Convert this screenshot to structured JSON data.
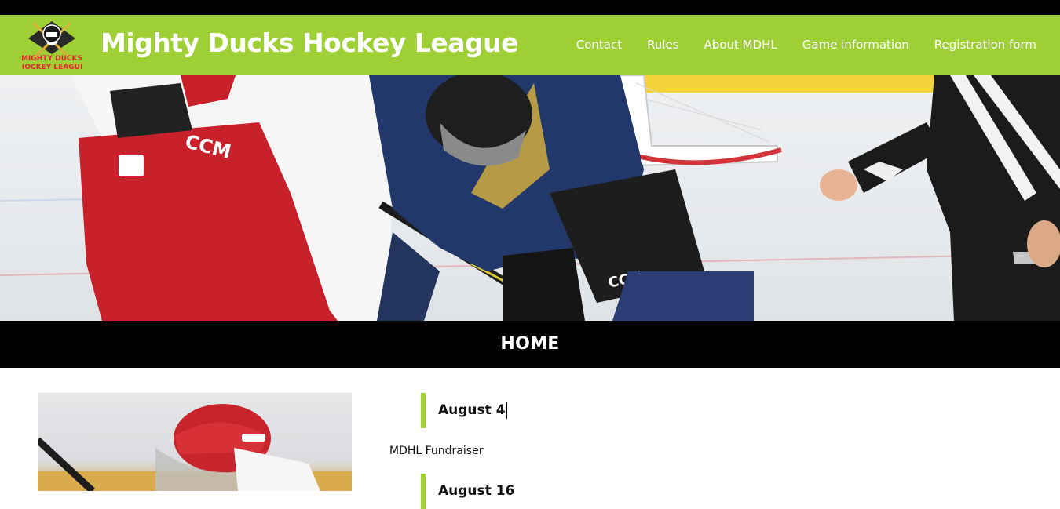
{
  "header": {
    "logo_text_line1": "MIGHTY DUCKS",
    "logo_text_line2": "HOCKEY LEAGUE",
    "site_title": "Mighty Ducks Hockey League",
    "nav": [
      {
        "label": "Contact"
      },
      {
        "label": "Rules"
      },
      {
        "label": "About MDHL"
      },
      {
        "label": "Game information"
      },
      {
        "label": "Registration form"
      }
    ]
  },
  "hero": {
    "brand_marks": [
      "CCM",
      "CCM"
    ]
  },
  "page": {
    "title": "HOME"
  },
  "events": [
    {
      "date": "August 4",
      "title": "MDHL Fundraiser"
    },
    {
      "date": "August 16"
    }
  ],
  "colors": {
    "accent": "#9ecf35",
    "dark": "#000000",
    "text": "#111111"
  }
}
